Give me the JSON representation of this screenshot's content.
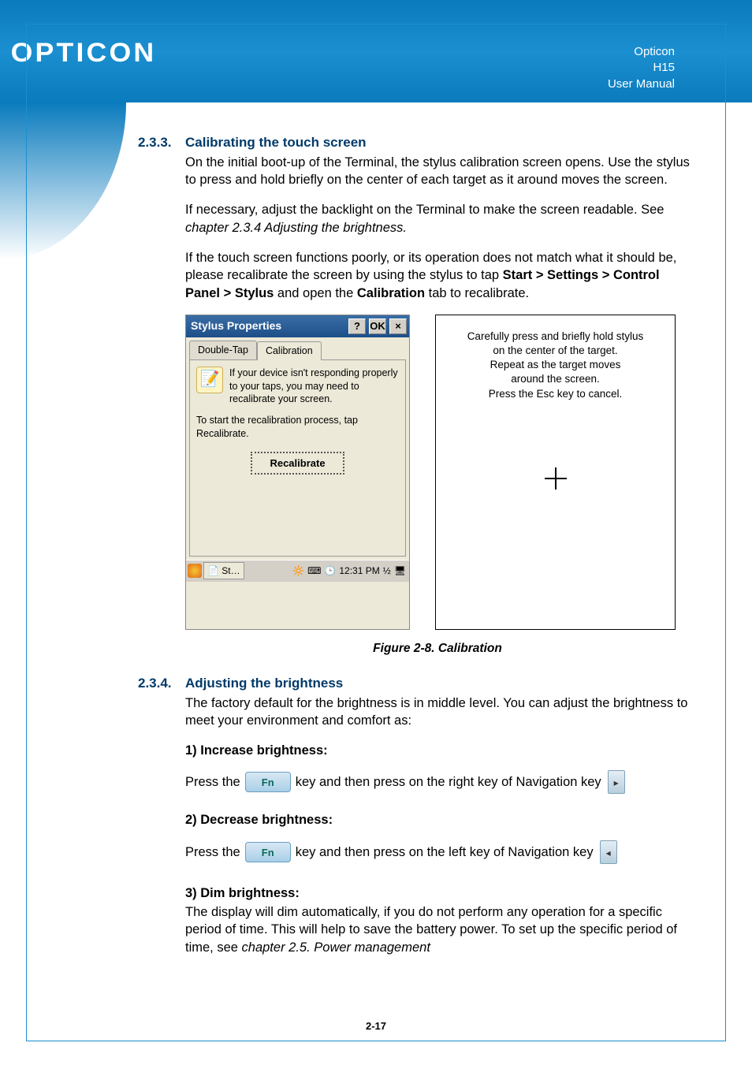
{
  "header": {
    "logo": "OPTICON",
    "right": [
      "Opticon",
      "H15",
      "User Manual"
    ]
  },
  "section233": {
    "num": "2.3.3.",
    "title": "Calibrating the touch screen",
    "p1": "On the initial boot-up of the Terminal, the stylus calibration screen opens. Use the stylus to press and hold briefly on the center of each target as it around moves the screen.",
    "p2a": "If necessary, adjust the backlight on the Terminal to make the screen readable. See ",
    "p2b": "chapter 2.3.4 Adjusting the brightness.",
    "p3a": "If the touch screen functions poorly, or its operation does not match what it should be, please recalibrate the screen by using the stylus to tap ",
    "p3b": "Start > Settings > Control Panel > Stylus",
    "p3c": " and open the ",
    "p3d": "Calibration",
    "p3e": " tab to recalibrate."
  },
  "stylusWin": {
    "title": "Stylus Properties",
    "help": "?",
    "ok": "OK",
    "close": "×",
    "tabs": {
      "doubleTap": "Double-Tap",
      "calibration": "Calibration"
    },
    "hint": "If your device isn't responding properly to your taps, you may need to recalibrate your screen.",
    "start": "To start the recalibration process, tap Recalibrate.",
    "recalBtn": "Recalibrate",
    "taskbar": {
      "app": "St…",
      "time": "12:31 PM"
    }
  },
  "calibBox": {
    "l1": "Carefully press and briefly hold stylus",
    "l2": "on the center of the target.",
    "l3": "Repeat as the target moves",
    "l4": "around the screen.",
    "l5": "Press the Esc key to cancel."
  },
  "figCaption": "Figure 2-8. Calibration",
  "section234": {
    "num": "2.3.4.",
    "title": "Adjusting the brightness",
    "intro": "The factory default for the brightness is in middle level. You can adjust the brightness to meet your environment and comfort as:",
    "s1h": "1) Increase brightness:",
    "s1a": "Press the ",
    "s1b": " key and then press on the right key of Navigation key ",
    "s2h": "2) Decrease brightness:",
    "s2a": "Press the ",
    "s2b": " key and then press on the left key of Navigation key ",
    "s3h": "3) Dim brightness:",
    "s3a": "The display will dim automatically, if you do not perform any operation for a specific period of time. This will help to save the battery power. To set up the specific period of time, see ",
    "s3b": "chapter 2.5. Power management"
  },
  "keys": {
    "fn": "Fn",
    "right": "▸",
    "left": "◂"
  },
  "pageNum": "2-17"
}
